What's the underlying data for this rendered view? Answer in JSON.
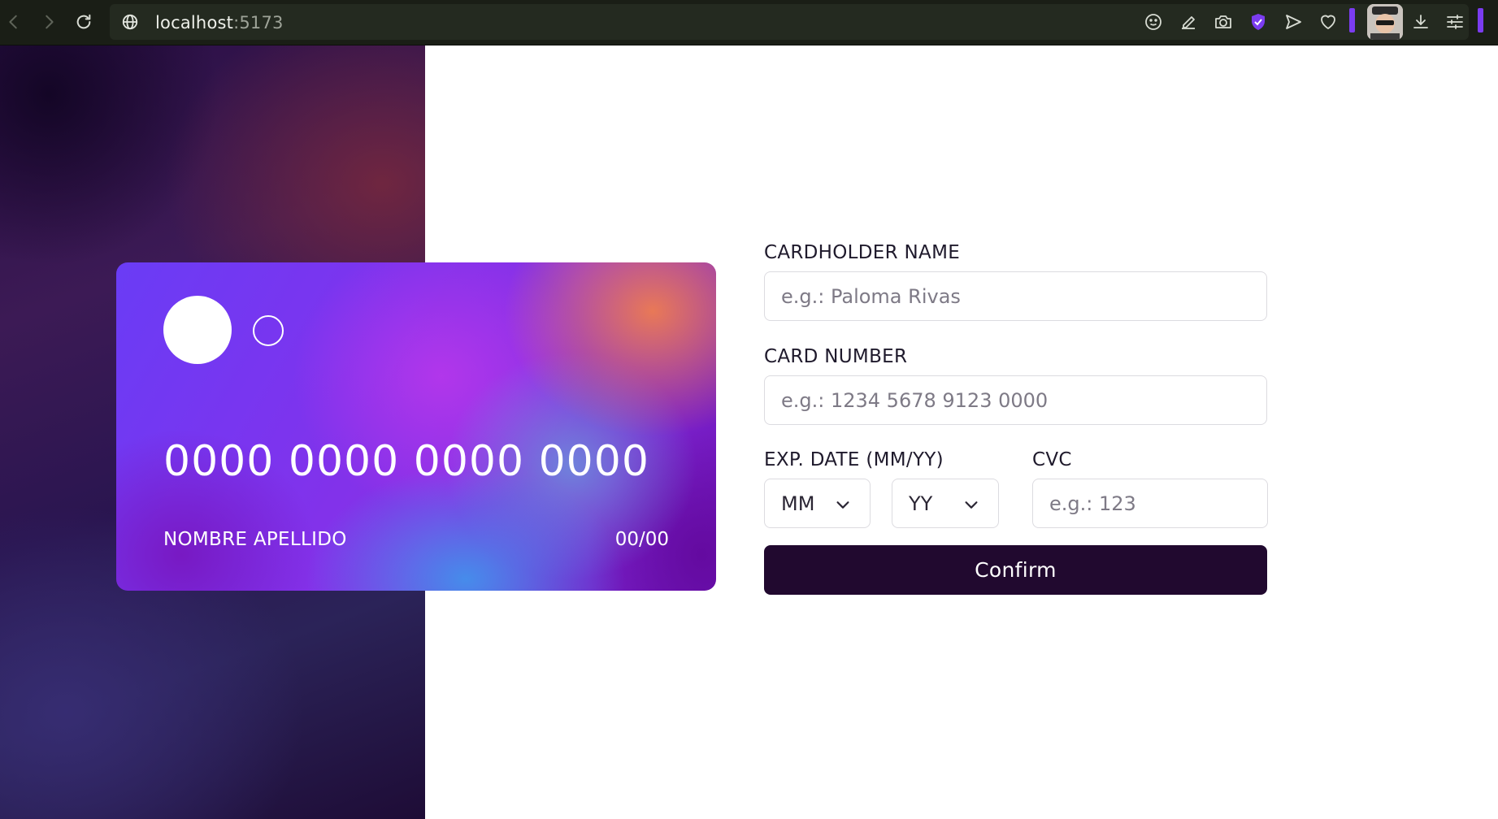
{
  "browser": {
    "url_host": "localhost",
    "url_port": ":5173",
    "icons": [
      "back-icon",
      "forward-icon",
      "reload-icon",
      "globe-icon",
      "emoji-icon",
      "share-edit-icon",
      "camera-icon",
      "shield-icon",
      "send-icon",
      "heart-icon",
      "download-icon",
      "settings-sliders-icon"
    ],
    "accent": "#7b3cf0"
  },
  "card": {
    "number": "0000 0000 0000 0000",
    "holder": "NOMBRE APELLIDO",
    "expiry": "00/00"
  },
  "form": {
    "name_label": "CARDHOLDER NAME",
    "name_placeholder": "e.g.: Paloma Rivas",
    "number_label": "CARD NUMBER",
    "number_placeholder": "e.g.: 1234 5678 9123 0000",
    "exp_label": "EXP. DATE (MM/YY)",
    "month_value": "MM",
    "year_value": "YY",
    "cvc_label": "CVC",
    "cvc_placeholder": "e.g.: 123",
    "confirm_label": "Confirm",
    "confirm_color": "#21092f"
  }
}
